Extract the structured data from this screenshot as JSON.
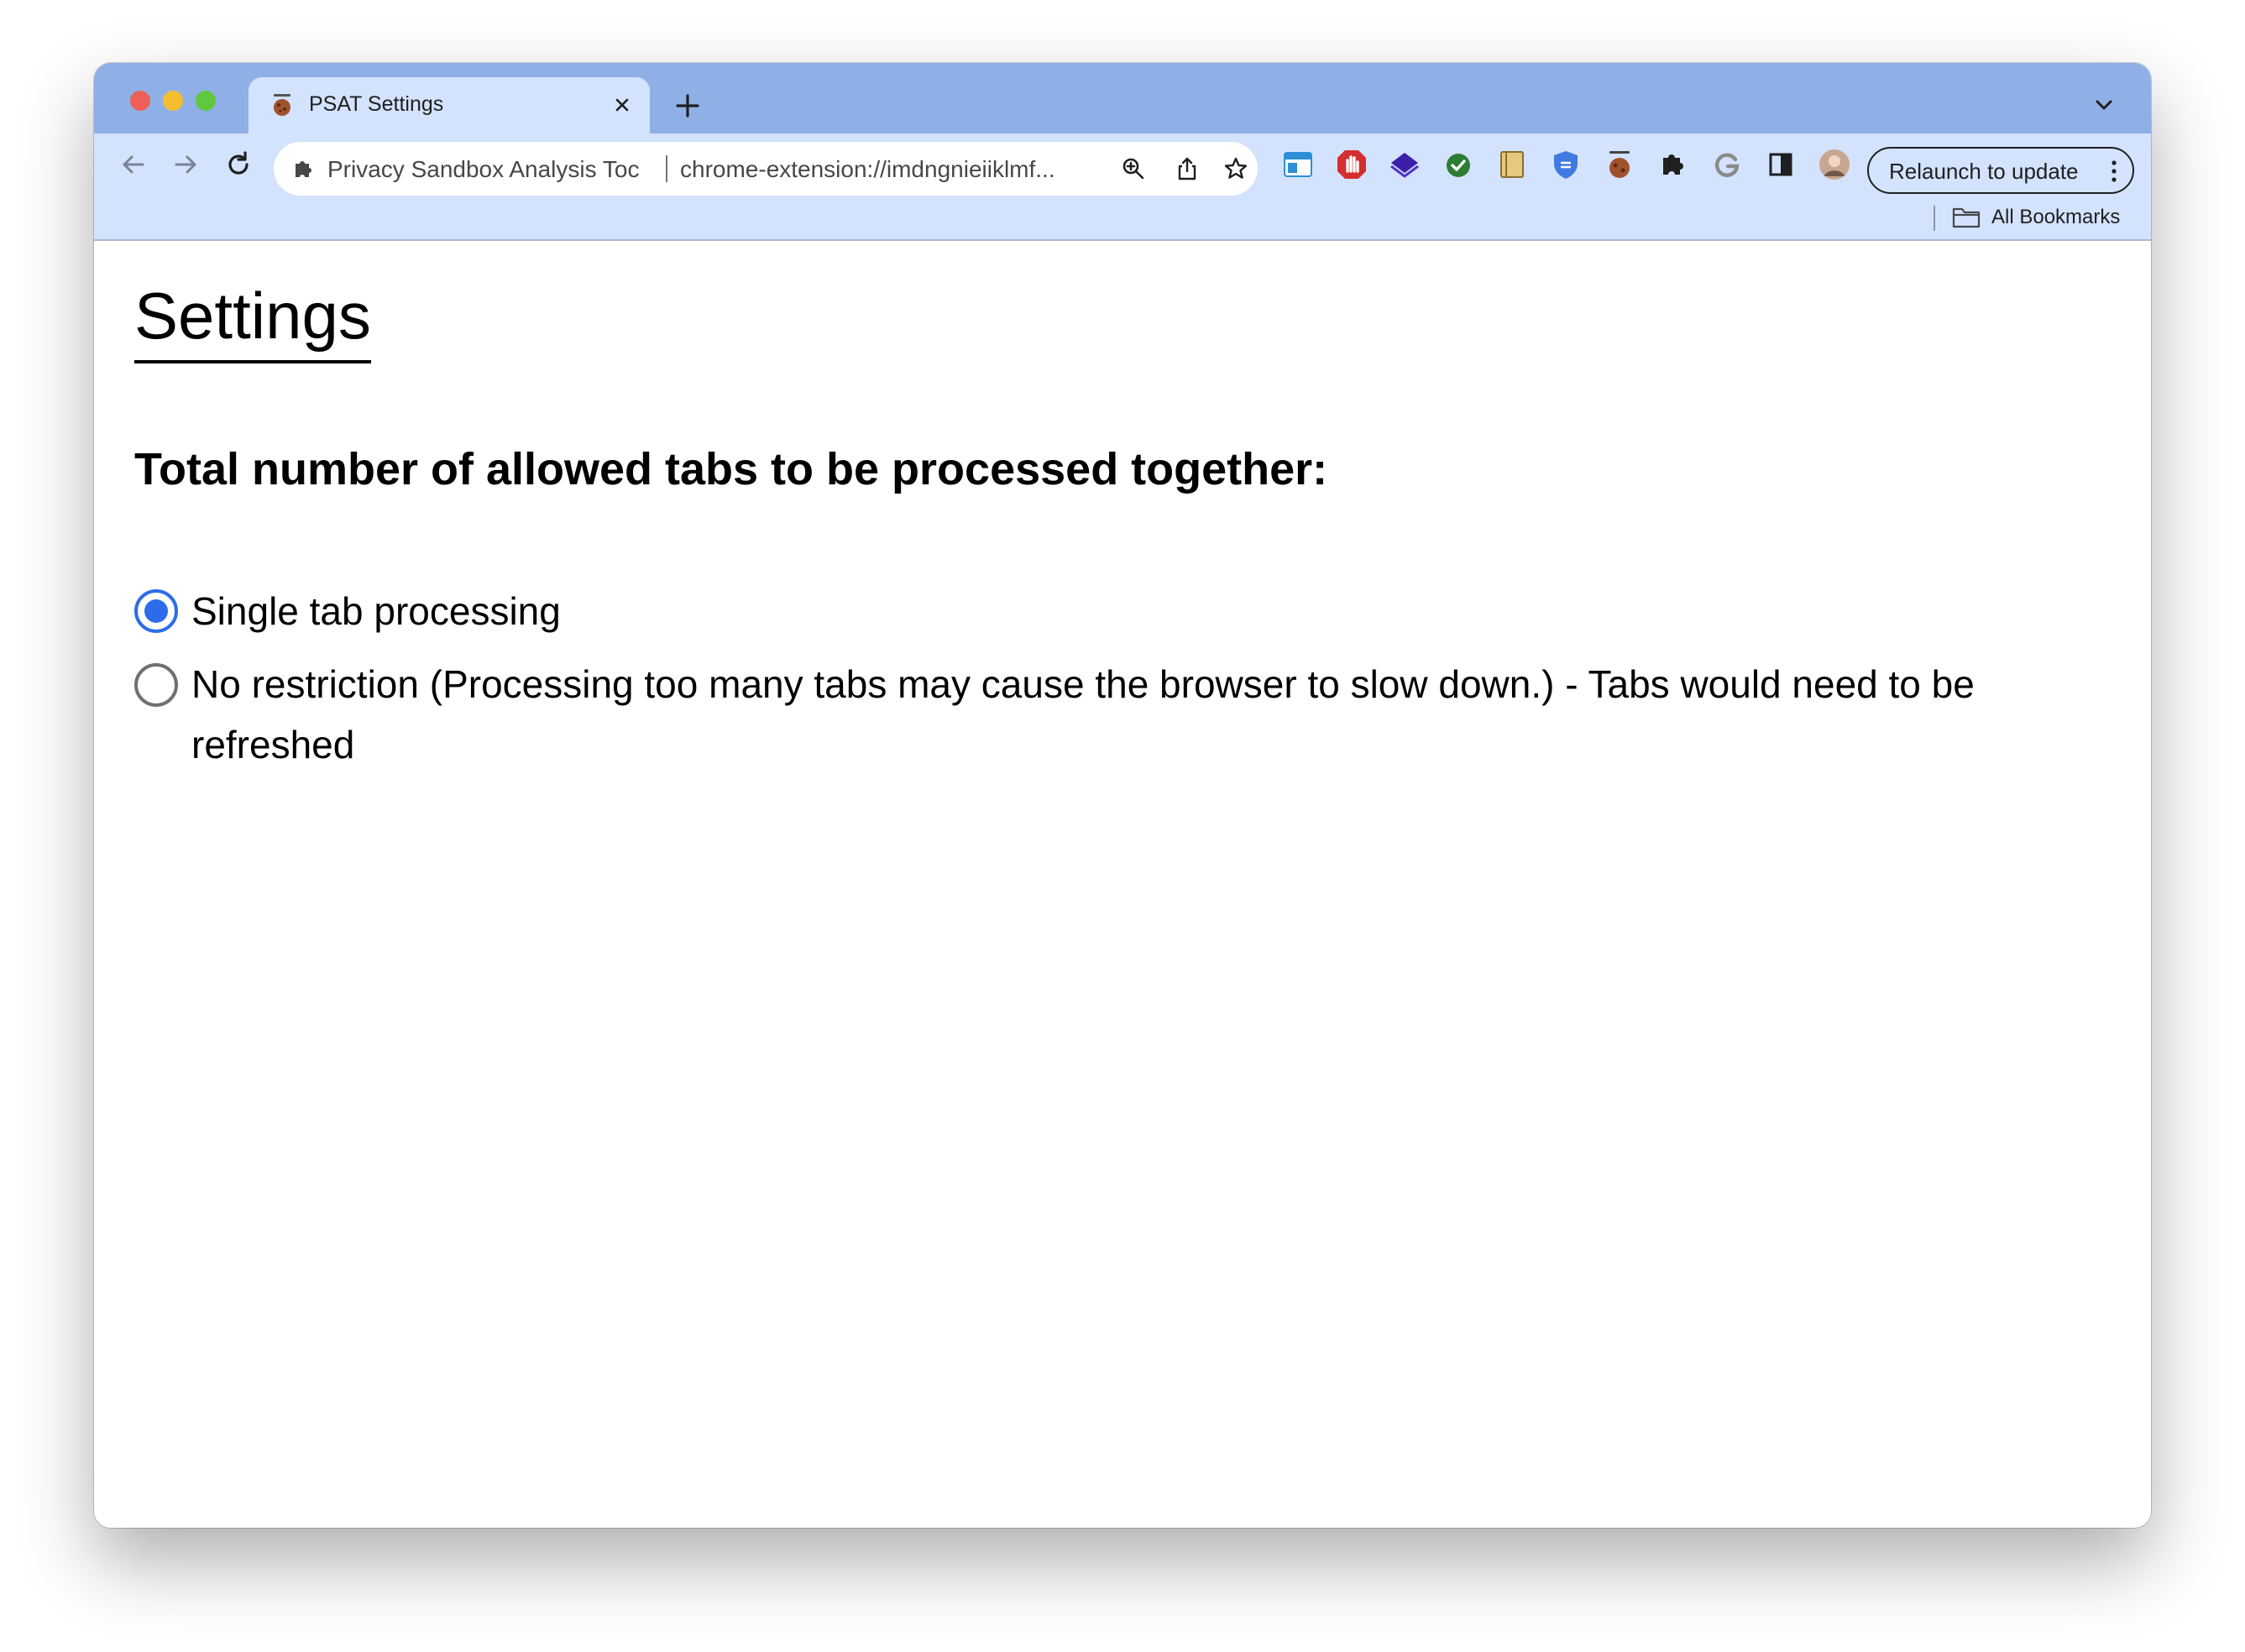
{
  "browser": {
    "tab": {
      "title": "PSAT Settings",
      "favicon": "psat-cookie-icon"
    },
    "address_bar": {
      "origin": "Privacy Sandbox Analysis Toc",
      "url": "chrome-extension://imdngnieiiklmf..."
    },
    "extensions": [
      "window-tiles-icon",
      "red-hand-stop-icon",
      "purple-stack-icon",
      "green-check-icon",
      "notebook-icon",
      "shield-icon",
      "psat-cookie-icon",
      "puzzle-piece-icon",
      "google-g-icon",
      "side-panel-icon",
      "profile-avatar"
    ],
    "relaunch_label": "Relaunch to update",
    "bookmarks_label": "All Bookmarks"
  },
  "page": {
    "title": "Settings",
    "question": "Total number of allowed tabs to be processed together:",
    "options": [
      {
        "label": "Single tab processing",
        "selected": true
      },
      {
        "label": "No restriction (Processing too many tabs may cause the browser to slow down.) - Tabs would need to be refreshed",
        "selected": false
      }
    ]
  },
  "colors": {
    "tabstrip": "#8fb0e6",
    "toolbar": "#d3e3fd",
    "radio_accent": "#2c6ce8"
  }
}
